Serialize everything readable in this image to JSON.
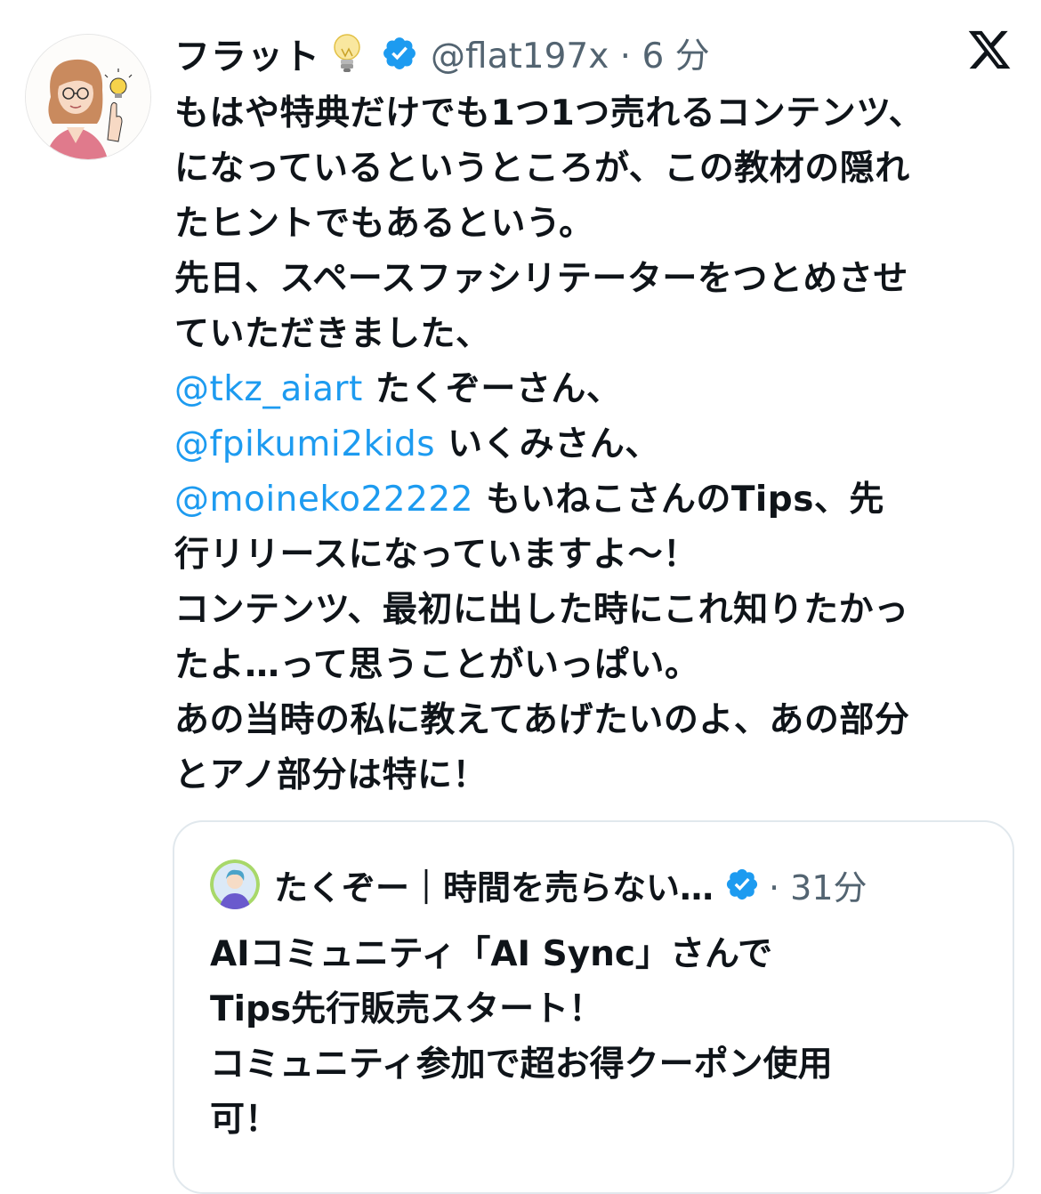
{
  "tweet": {
    "author": {
      "display_name": "フラット",
      "emoji": "💡",
      "handle_time": "@flat197x · 6 分",
      "verified_icon": "verified-badge-icon"
    },
    "brand_icon": "x-logo-icon",
    "lines": [
      [
        {
          "t": "もはや特典だけでも1つ1つ売れるコンテンツ、"
        }
      ],
      [
        {
          "t": "になっているというところが、この教材の隠れ"
        }
      ],
      [
        {
          "t": "たヒントでもあるという。"
        }
      ],
      [
        {
          "t": "先日、スペースファシリテーターをつとめさせ"
        }
      ],
      [
        {
          "t": "ていただきました、"
        }
      ],
      [
        {
          "t": "@tkz_aiart",
          "m": true
        },
        {
          "t": " たくぞーさん、"
        }
      ],
      [
        {
          "t": " "
        },
        {
          "t": "@fpikumi2kids",
          "m": true
        },
        {
          "t": " いくみさん、"
        }
      ],
      [
        {
          "t": " "
        },
        {
          "t": "@moineko22222",
          "m": true
        },
        {
          "t": " もいねこさんのTips、先"
        }
      ],
      [
        {
          "t": "行リリースになっていますよ〜！"
        }
      ],
      [
        {
          "t": "コンテンツ、最初に出した時にこれ知りたかっ"
        }
      ],
      [
        {
          "t": "たよ…って思うことがいっぱい。"
        }
      ],
      [
        {
          "t": "あの当時の私に教えてあげたいのよ、あの部分"
        }
      ],
      [
        {
          "t": "とアノ部分は特に！"
        }
      ]
    ],
    "mention_color": "#1d9bf0"
  },
  "quote": {
    "author": {
      "display_name": "たくぞー｜時間を売らない…",
      "time": "· 31分",
      "verified_icon": "verified-badge-icon"
    },
    "lines": [
      "AIコミュニティ「AI Sync」さんで",
      "Tips先行販売スタート！",
      "コミュニティ参加で超お得クーポン使用",
      "可！"
    ]
  },
  "colors": {
    "verified": "#1d9bf0",
    "secondary_text": "#536471",
    "border": "#e1e8ed"
  }
}
